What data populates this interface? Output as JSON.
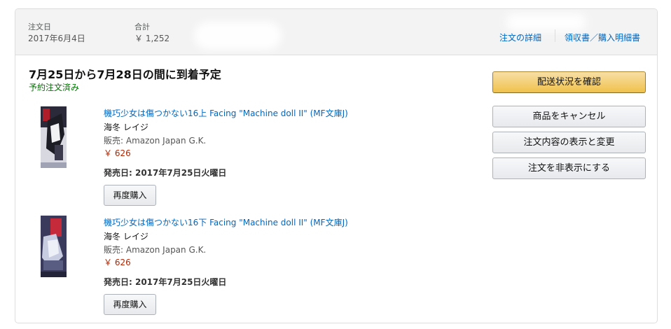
{
  "header": {
    "order_date_label": "注文日",
    "order_date": "2017年6月4日",
    "total_label": "合計",
    "total": "￥ 1,252",
    "details_link": "注文の詳細",
    "receipt_link": "領収書／購入明細書"
  },
  "shipment": {
    "title": "7月25日から7月28日の間に到着予定",
    "status": "予約注文済み",
    "status_color": "#007600"
  },
  "items": [
    {
      "title": "機巧少女は傷つかない16上 Facing \"Machine doll II\" (MF文庫J)",
      "author": "海冬 レイジ",
      "seller": "販売: Amazon Japan G.K.",
      "price": "￥ 626",
      "release": "発売日: 2017年7月25日火曜日",
      "buy_again": "再度購入"
    },
    {
      "title": "機巧少女は傷つかない16下 Facing \"Machine doll II\" (MF文庫J)",
      "author": "海冬 レイジ",
      "seller": "販売: Amazon Japan G.K.",
      "price": "￥ 626",
      "release": "発売日: 2017年7月25日火曜日",
      "buy_again": "再度購入"
    }
  ],
  "actions": {
    "track": "配送状況を確認",
    "cancel": "商品をキャンセル",
    "view_edit": "注文内容の表示と変更",
    "hide": "注文を非表示にする"
  },
  "colors": {
    "link": "#0066c0",
    "price": "#b12704",
    "primary_button": "#f0c14b"
  }
}
